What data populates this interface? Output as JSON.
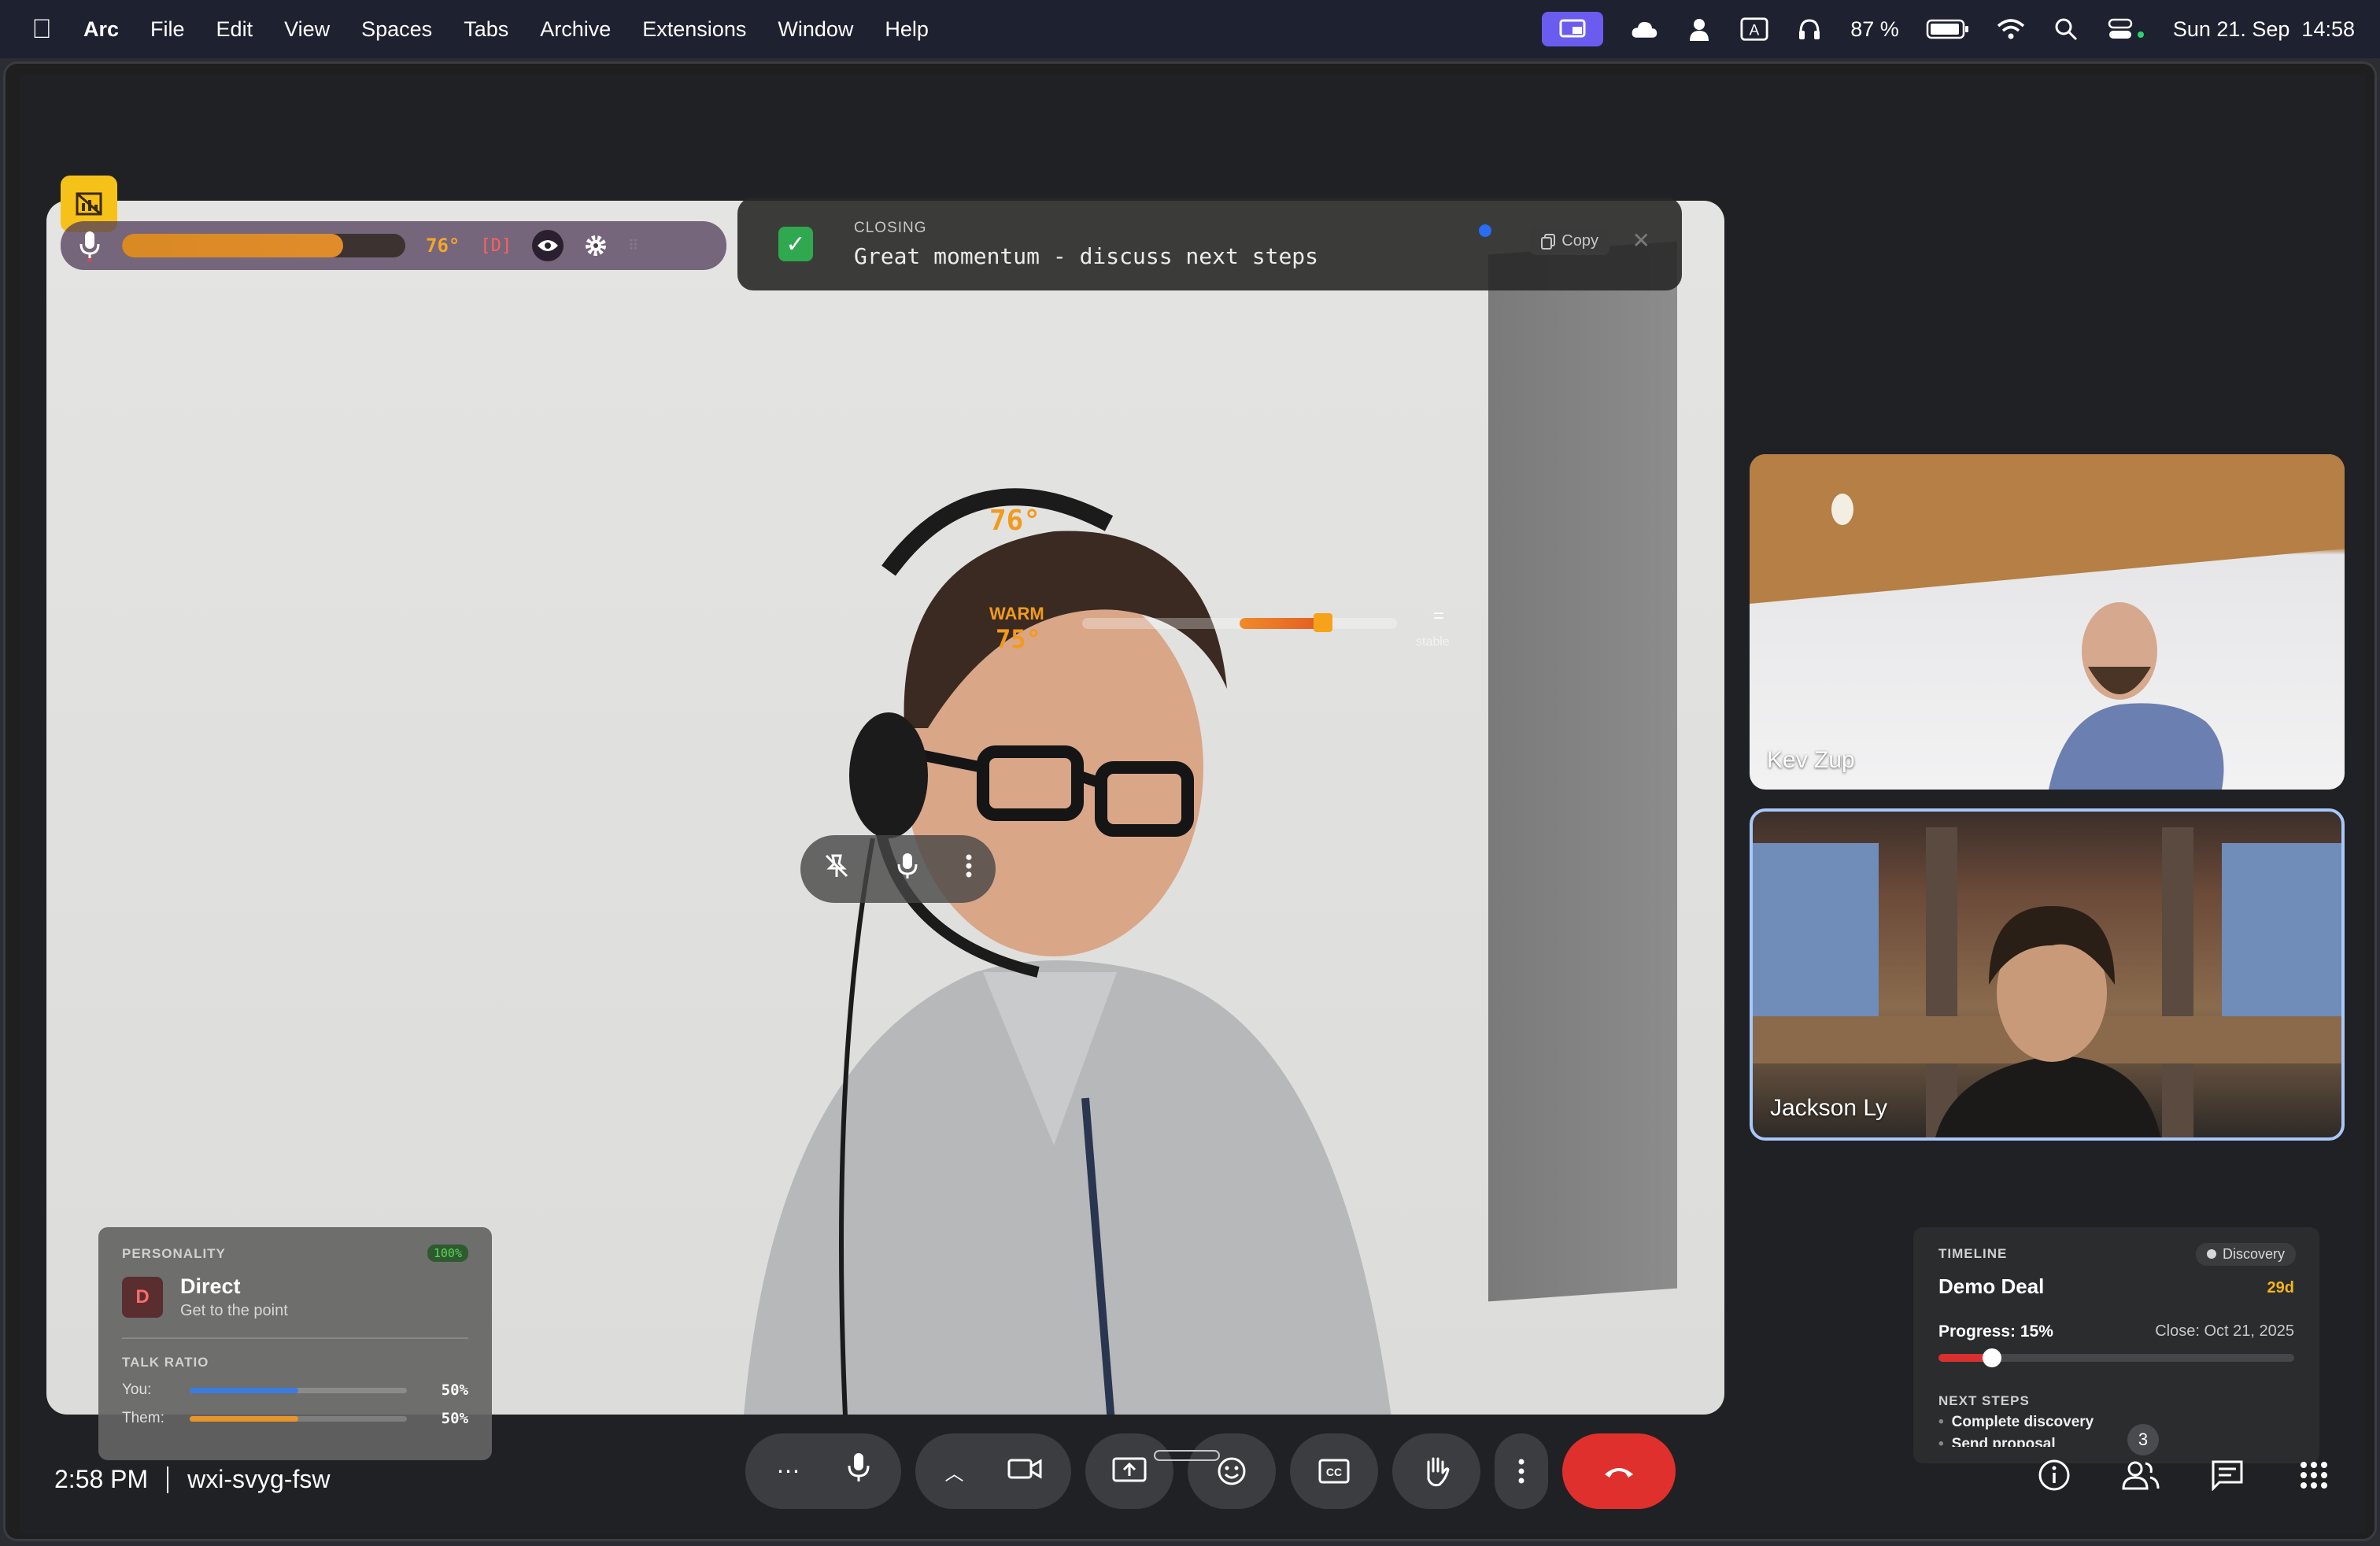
{
  "menubar": {
    "app": "Arc",
    "items": [
      "File",
      "Edit",
      "View",
      "Spaces",
      "Tabs",
      "Archive",
      "Extensions",
      "Window",
      "Help"
    ],
    "battery": "87 %",
    "datetime": "Sun 21. Sep  14:58"
  },
  "overlay": {
    "temperature": "76°",
    "mode": "[D]",
    "temperature_level": 0.78
  },
  "closing_card": {
    "label": "CLOSING",
    "text": "Great momentum - discuss next steps",
    "copy_label": "Copy"
  },
  "hud": {
    "temperature": "76°",
    "warm_label": "WARM",
    "warm_value": "75°",
    "stable_label": "stable"
  },
  "participants": [
    {
      "name": "Kev Zup"
    },
    {
      "name": "Jackson Ly"
    }
  ],
  "personality": {
    "label": "PERSONALITY",
    "confidence": "100%",
    "badge": "D",
    "title": "Direct",
    "subtitle": "Get to the point",
    "talk_ratio_label": "TALK RATIO",
    "talk_ratio": [
      {
        "name": "You:",
        "value": "50%",
        "fraction": 0.5,
        "color": "#3a7be0"
      },
      {
        "name": "Them:",
        "value": "50%",
        "fraction": 0.5,
        "color": "#e8952c"
      }
    ]
  },
  "timeline": {
    "label": "TIMELINE",
    "stage": "Discovery",
    "deal": "Demo Deal",
    "days_left": "29d",
    "progress_label": "Progress: 15%",
    "progress_fraction": 0.15,
    "close_date": "Close: Oct 21, 2025",
    "next_steps_label": "NEXT STEPS",
    "next_steps": [
      "Complete discovery",
      "Send proposal"
    ]
  },
  "meeting": {
    "time": "2:58 PM",
    "code": "wxi-svyg-fsw",
    "participant_count": "3"
  },
  "colors": {
    "accent_orange": "#f29a1d",
    "end_call_red": "#e0302d",
    "active_tile_border": "#a8c7fa"
  }
}
